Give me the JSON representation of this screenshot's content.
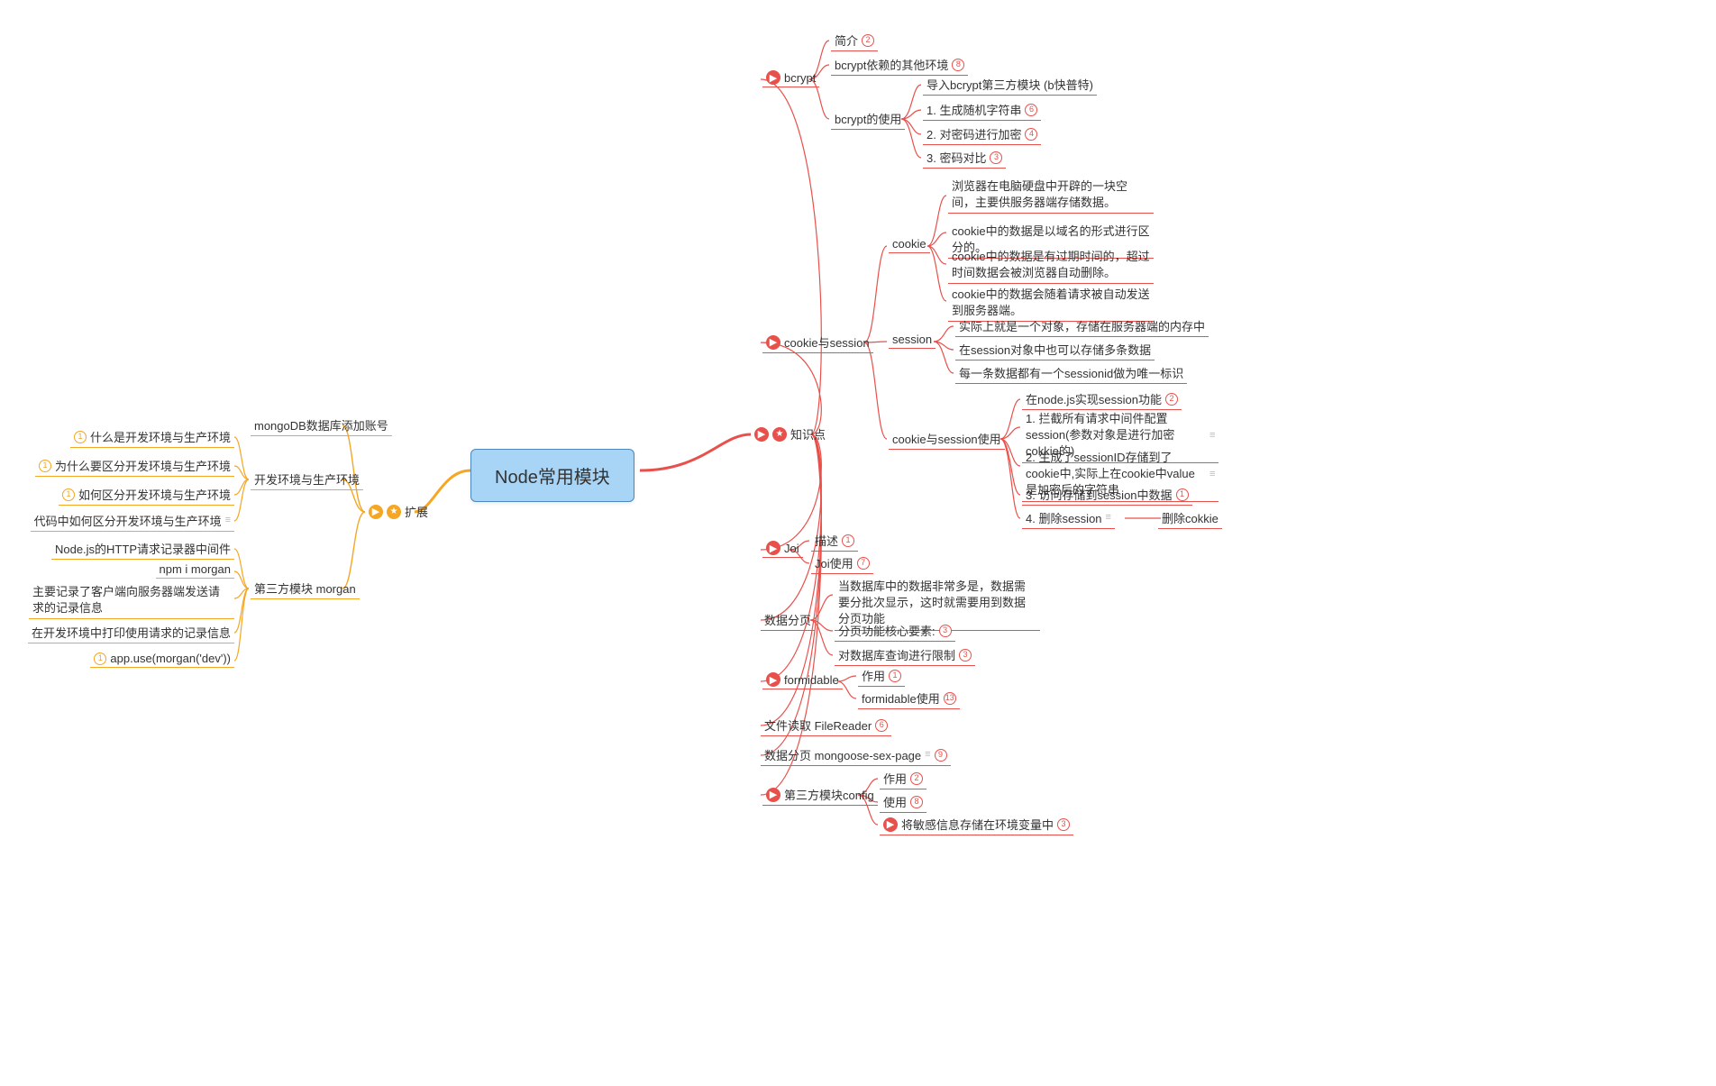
{
  "root": {
    "title": "Node常用模块"
  },
  "left": {
    "title": "扩展",
    "branches": {
      "mongo": "mongoDB数据库添加账号",
      "env": {
        "title": "开发环境与生产环境",
        "children": [
          "什么是开发环境与生产环境",
          "为什么要区分开发环境与生产环境",
          "如何区分开发环境与生产环境",
          "代码中如何区分开发环境与生产环境"
        ]
      },
      "morgan": {
        "title": "第三方模块 morgan",
        "children": [
          "Node.js的HTTP请求记录器中间件",
          "npm i morgan",
          "主要记录了客户端向服务器端发送请求的记录信息",
          "在开发环境中打印使用请求的记录信息",
          "app.use(morgan('dev'))"
        ]
      }
    }
  },
  "right": {
    "title": "知识点",
    "bcrypt": {
      "title": "bcrypt",
      "intro": "简介",
      "deps": "bcrypt依赖的其他环境",
      "usage_title": "bcrypt的使用",
      "usage": {
        "import": "导入bcrypt第三方模块 (b快普特)",
        "gen": "1. 生成随机字符串",
        "enc": "2. 对密码进行加密",
        "cmp": "3. 密码对比"
      }
    },
    "cs": {
      "title": "cookie与session",
      "cookie": {
        "title": "cookie",
        "c1": "浏览器在电脑硬盘中开辟的一块空间，主要供服务器端存储数据。",
        "c2": "cookie中的数据是以域名的形式进行区分的。",
        "c3": "cookie中的数据是有过期时间的，超过时间数据会被浏览器自动删除。",
        "c4": "cookie中的数据会随着请求被自动发送到服务器端。"
      },
      "session": {
        "title": "session",
        "s1": "实际上就是一个对象，存储在服务器端的内存中",
        "s2": "在session对象中也可以存储多条数据",
        "s3": "每一条数据都有一个sessionid做为唯一标识"
      },
      "use": {
        "title": "cookie与session使用",
        "u1": "在node.js实现session功能",
        "u2": "1. 拦截所有请求中间件配置session(参数对象是进行加密cokkie的)",
        "u3": "2. 生成了sessionID存储到了cookie中,实际上在cookie中value是加密后的字符串",
        "u4": "3. 访问存储到session中数据",
        "u5": "4. 删除session",
        "u5b": "删除cokkie"
      }
    },
    "joi": {
      "title": "Joi",
      "desc": "描述",
      "use": "Joi使用"
    },
    "page": {
      "title": "数据分页",
      "p1": "当数据库中的数据非常多是，数据需要分批次显示，这时就需要用到数据分页功能",
      "p2": "分页功能核心要素:",
      "p3": "对数据库查询进行限制"
    },
    "formidable": {
      "title": "formidable",
      "f1": "作用",
      "f2": "formidable使用"
    },
    "filereader": "文件读取 FileReader",
    "mongoosepage": "数据分页 mongoose-sex-page",
    "config": {
      "title": "第三方模块config",
      "c1": "作用",
      "c2": "使用",
      "c3": "将敏感信息存储在环境变量中"
    }
  },
  "badges": {
    "b2": "2",
    "b3": "3",
    "b4": "4",
    "b6": "6",
    "b7": "7",
    "b8": "8",
    "b1": "1",
    "b9": "9",
    "b13": "13"
  }
}
